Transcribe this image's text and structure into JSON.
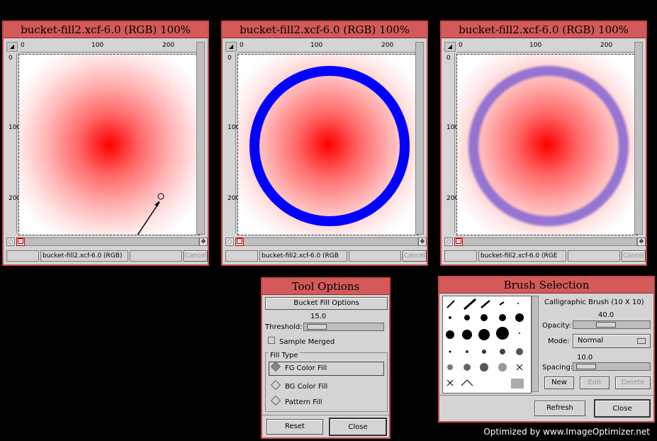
{
  "image_windows": [
    {
      "title": "bucket-fill2.xcf-6.0 (RGB) 100%",
      "status_file": "bucket-fill2.xcf-6.0 (RGB)",
      "cancel_label": "Cancel",
      "ruler_ticks_h": [
        "0",
        "100",
        "200"
      ],
      "ruler_ticks_v": [
        "0",
        "100",
        "200"
      ]
    },
    {
      "title": "bucket-fill2.xcf-6.0 (RGB) 100%",
      "status_file": "bucket-fill2.xcf-6.0 (RGB",
      "cancel_label": "Cancel",
      "ruler_ticks_h": [
        "0",
        "100",
        "200"
      ],
      "ruler_ticks_v": [
        "0",
        "100",
        "200"
      ]
    },
    {
      "title": "bucket-fill2.xcf-6.0 (RGB) 100%",
      "status_file": "bucket-fill2.xcf-6.0 (RGE",
      "cancel_label": "Cancel",
      "ruler_ticks_h": [
        "0",
        "100",
        "200"
      ],
      "ruler_ticks_v": [
        "0",
        "100",
        "200"
      ]
    }
  ],
  "tool_options": {
    "title": "Tool Options",
    "section_button": "Bucket Fill Options",
    "threshold_value": "15.0",
    "threshold_label": "Threshold:",
    "sample_merged": "Sample Merged",
    "fill_type_label": "Fill Type",
    "fill_options": [
      "FG Color Fill",
      "BG Color Fill",
      "Pattern Fill"
    ],
    "selected_fill": "FG Color Fill",
    "reset": "Reset",
    "close": "Close"
  },
  "brush_selection": {
    "title": "Brush Selection",
    "brush_name": "Calligraphic Brush  (10 X 10)",
    "opacity_value": "40.0",
    "opacity_label": "Opacity:",
    "mode_label": "Mode:",
    "mode_value": "Normal",
    "spacing_value": "10.0",
    "spacing_label": "Spacing:",
    "new": "New",
    "edit": "Edit",
    "delete": "Delete",
    "refresh": "Refresh",
    "close": "Close"
  },
  "credit": "Optimized by www.ImageOptimizer.net",
  "colors": {
    "ring_blue": "#0000ff",
    "ring_purple": "#8f6fd0",
    "center_red": "#ff0000",
    "title_red": "#d45a5a"
  }
}
